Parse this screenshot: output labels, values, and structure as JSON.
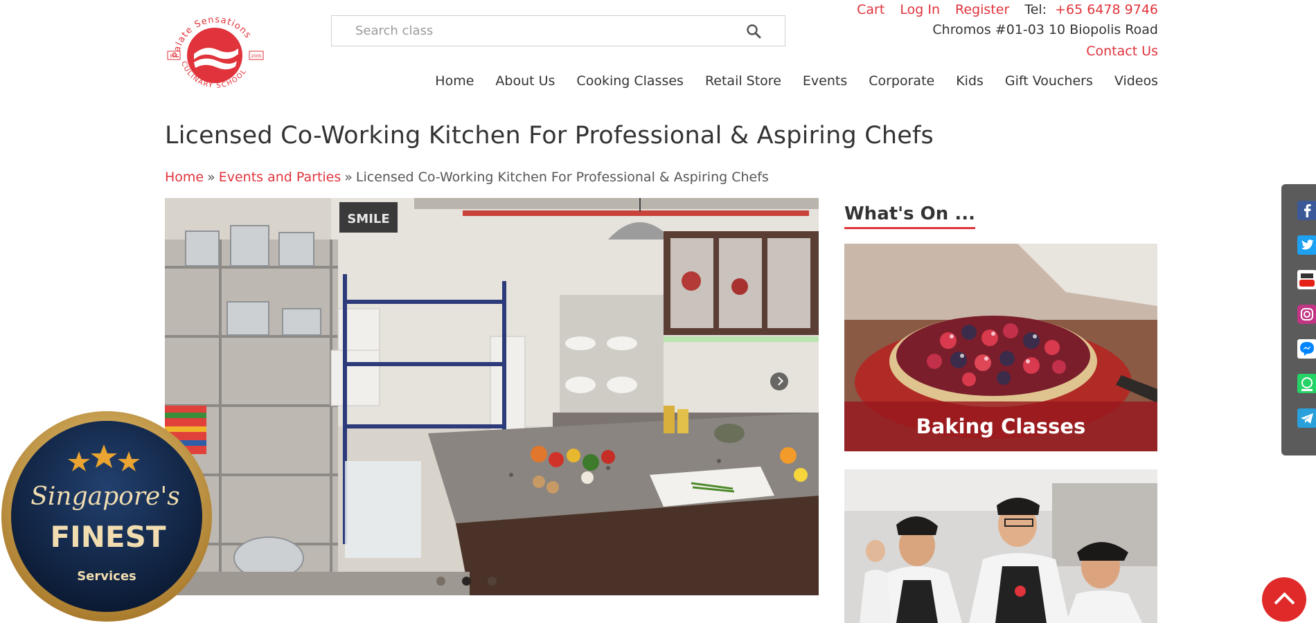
{
  "brand": {
    "logo_arc_top": "Palate Sensations",
    "logo_arc_bottom": "CULINARY SCHOOL",
    "logo_est": "EST",
    "logo_year": "2005",
    "accent_color": "#e0333b"
  },
  "search": {
    "placeholder": "Search class",
    "icon": "search-icon"
  },
  "top_links": {
    "cart": "Cart",
    "login": "Log In",
    "register": "Register",
    "tel_label": "Tel:",
    "tel_number": "+65 6478 9746"
  },
  "address": "Chromos #01-03 10 Biopolis Road",
  "contact": "Contact Us",
  "nav": {
    "items": [
      "Home",
      "About Us",
      "Cooking Classes",
      "Retail Store",
      "Events",
      "Corporate",
      "Kids",
      "Gift Vouchers",
      "Videos"
    ]
  },
  "page": {
    "title": "Licensed Co-Working Kitchen For Professional & Aspiring Chefs"
  },
  "breadcrumb": {
    "home": "Home",
    "separator": "»",
    "events": "Events and Parties",
    "current": "Licensed Co-Working Kitchen For Professional & Aspiring Chefs"
  },
  "hero": {
    "sign_text": "SMILE",
    "slide_count": 3,
    "active_slide": 2
  },
  "sidebar": {
    "heading": "What's On ...",
    "promos": [
      {
        "label": "Baking Classes"
      },
      {
        "label": ""
      }
    ]
  },
  "social": {
    "icons": [
      "facebook-icon",
      "twitter-icon",
      "youtube-icon",
      "instagram-icon",
      "messenger-icon",
      "whatsapp-icon",
      "telegram-icon"
    ]
  },
  "badge": {
    "line1": "Singapore's",
    "line2": "FINEST",
    "line3": "Services"
  }
}
